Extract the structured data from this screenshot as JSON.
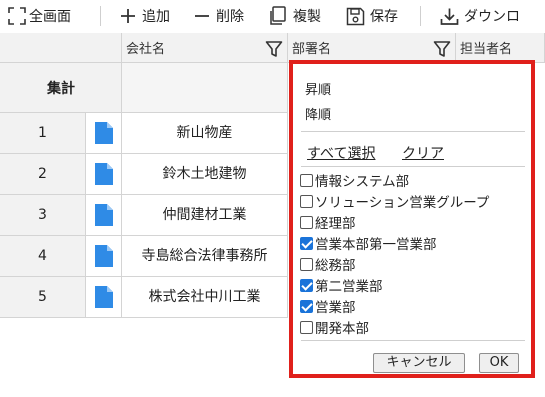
{
  "toolbar": {
    "fullscreen": "全画面",
    "add": "追加",
    "delete": "削除",
    "copy": "複製",
    "save": "保存",
    "download": "ダウンロ"
  },
  "grid": {
    "columns": [
      "会社名",
      "部署名",
      "担当者名"
    ],
    "summary_label": "集計",
    "rows": [
      {
        "num": "1",
        "company": "新山物産"
      },
      {
        "num": "2",
        "company": "鈴木土地建物"
      },
      {
        "num": "3",
        "company": "仲間建材工業"
      },
      {
        "num": "4",
        "company": "寺島総合法律事務所"
      },
      {
        "num": "5",
        "company": "株式会社中川工業"
      }
    ]
  },
  "filter_popup": {
    "sort_asc": "昇順",
    "sort_desc": "降順",
    "select_all": "すべて選択",
    "clear": "クリア",
    "options": [
      {
        "label": "情報システム部",
        "checked": false
      },
      {
        "label": "ソリューション営業グループ",
        "checked": false
      },
      {
        "label": "経理部",
        "checked": false
      },
      {
        "label": "営業本部第一営業部",
        "checked": true
      },
      {
        "label": "総務部",
        "checked": false
      },
      {
        "label": "第二営業部",
        "checked": true
      },
      {
        "label": "営業部",
        "checked": true
      },
      {
        "label": "開発本部",
        "checked": false
      }
    ],
    "cancel": "キャンセル",
    "ok": "OK"
  },
  "colors": {
    "highlight_border": "#e0201b",
    "checkbox_checked": "#1a73d9",
    "doc_icon": "#2f8be6",
    "header_bg": "#f2f2f2"
  }
}
